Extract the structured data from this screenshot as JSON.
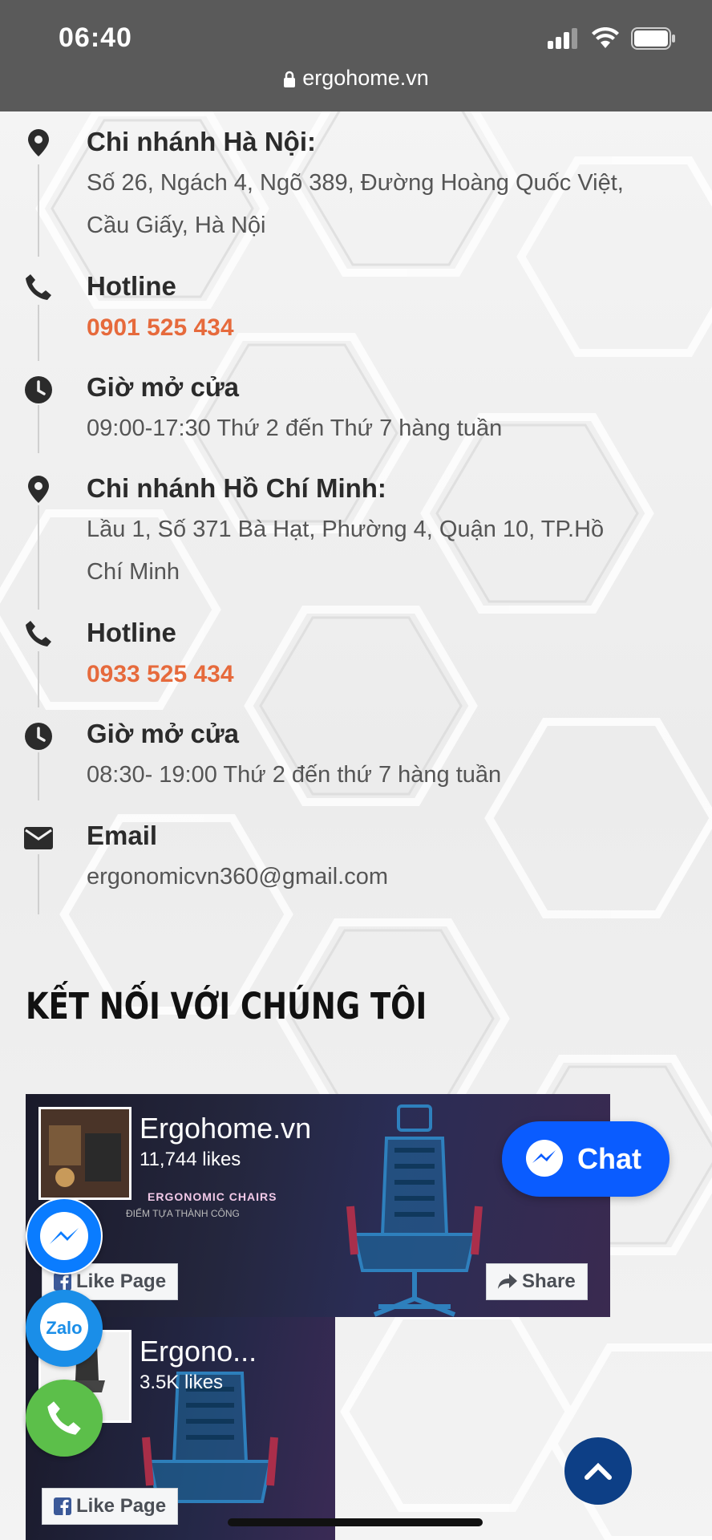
{
  "status_bar": {
    "time": "06:40",
    "url": "ergohome.vn"
  },
  "contacts": [
    {
      "icon": "map-marker-icon",
      "title": "Chi nhánh Hà Nội:",
      "line1": "Số 26, Ngách 4, Ngõ 389, Đường Hoàng Quốc Việt,",
      "line2": "Cầu Giấy, Hà Nội"
    },
    {
      "icon": "phone-icon",
      "title": "Hotline",
      "phone": "0901 525 434"
    },
    {
      "icon": "clock-icon",
      "title": "Giờ mở cửa",
      "line1": "09:00-17:30 Thứ 2 đến Thứ 7 hàng tuần"
    },
    {
      "icon": "map-marker-icon",
      "title": "Chi nhánh Hồ Chí Minh:",
      "line1": "Lầu 1, Số 371 Bà Hạt, Phường 4, Quận 10, TP.Hồ",
      "line2": "Chí Minh"
    },
    {
      "icon": "phone-icon",
      "title": "Hotline",
      "phone": "0933 525 434"
    },
    {
      "icon": "clock-icon",
      "title": "Giờ mở cửa",
      "line1": "08:30- 19:00 Thứ 2 đến thứ 7 hàng tuần"
    },
    {
      "icon": "envelope-icon",
      "title": "Email",
      "line1": "ergonomicvn360@gmail.com"
    }
  ],
  "connect_section": {
    "title": "KẾT NỐI VỚI CHÚNG TÔI"
  },
  "facebook_pages": [
    {
      "name": "Ergohome.vn",
      "likes": "11,744 likes",
      "like_label": "Like Page",
      "share_label": "Share",
      "banner_text": "ERGONOMIC CHAIRS",
      "banner_sub": "ĐIỂM TỰA THÀNH CÔNG"
    },
    {
      "name": "Ergono...",
      "likes": "3.5K likes",
      "like_label": "Like Page"
    }
  ],
  "floating": {
    "chat_label": "Chat",
    "zalo_label": "Zalo"
  },
  "colors": {
    "accent_phone": "#e66a3c",
    "messenger_blue": "#0a5cff",
    "call_green": "#5cbf4a",
    "back_to_top": "#0d3f86"
  }
}
